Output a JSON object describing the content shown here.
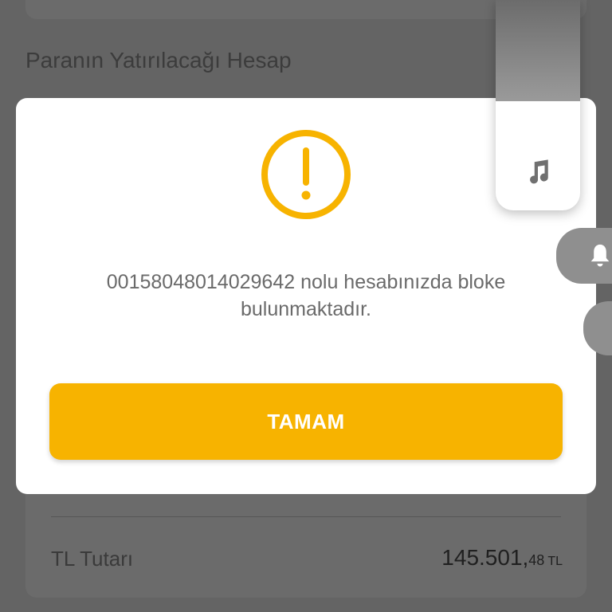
{
  "background": {
    "section_title": "Paranın Yatırılacağı Hesap",
    "amount_row": {
      "label": "TL Tutarı",
      "value_main": "145.501,",
      "value_cents": "48",
      "currency": "TL"
    }
  },
  "dialog": {
    "icon": "alert-circle-icon",
    "message": "00158048014029642 nolu hesabınızda bloke bulunmaktadır.",
    "ok_label": "TAMAM"
  },
  "volume_overlay": {
    "music_icon": "music-note-icon",
    "bell_icon": "bell-icon",
    "level_fraction": 0.52
  },
  "colors": {
    "accent": "#F7B300",
    "scrim": "#646464",
    "dialog_bg": "#FFFFFF",
    "message_text": "#6A6A6A"
  }
}
